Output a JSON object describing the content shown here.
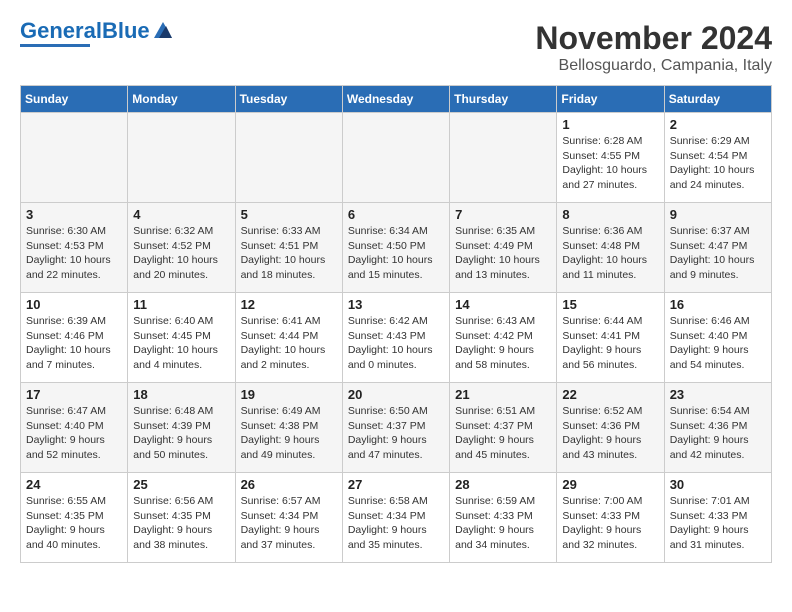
{
  "header": {
    "logo_general": "General",
    "logo_blue": "Blue",
    "title": "November 2024",
    "subtitle": "Bellosguardo, Campania, Italy"
  },
  "calendar": {
    "weekdays": [
      "Sunday",
      "Monday",
      "Tuesday",
      "Wednesday",
      "Thursday",
      "Friday",
      "Saturday"
    ],
    "weeks": [
      [
        {
          "day": "",
          "info": ""
        },
        {
          "day": "",
          "info": ""
        },
        {
          "day": "",
          "info": ""
        },
        {
          "day": "",
          "info": ""
        },
        {
          "day": "",
          "info": ""
        },
        {
          "day": "1",
          "info": "Sunrise: 6:28 AM\nSunset: 4:55 PM\nDaylight: 10 hours\nand 27 minutes."
        },
        {
          "day": "2",
          "info": "Sunrise: 6:29 AM\nSunset: 4:54 PM\nDaylight: 10 hours\nand 24 minutes."
        }
      ],
      [
        {
          "day": "3",
          "info": "Sunrise: 6:30 AM\nSunset: 4:53 PM\nDaylight: 10 hours\nand 22 minutes."
        },
        {
          "day": "4",
          "info": "Sunrise: 6:32 AM\nSunset: 4:52 PM\nDaylight: 10 hours\nand 20 minutes."
        },
        {
          "day": "5",
          "info": "Sunrise: 6:33 AM\nSunset: 4:51 PM\nDaylight: 10 hours\nand 18 minutes."
        },
        {
          "day": "6",
          "info": "Sunrise: 6:34 AM\nSunset: 4:50 PM\nDaylight: 10 hours\nand 15 minutes."
        },
        {
          "day": "7",
          "info": "Sunrise: 6:35 AM\nSunset: 4:49 PM\nDaylight: 10 hours\nand 13 minutes."
        },
        {
          "day": "8",
          "info": "Sunrise: 6:36 AM\nSunset: 4:48 PM\nDaylight: 10 hours\nand 11 minutes."
        },
        {
          "day": "9",
          "info": "Sunrise: 6:37 AM\nSunset: 4:47 PM\nDaylight: 10 hours\nand 9 minutes."
        }
      ],
      [
        {
          "day": "10",
          "info": "Sunrise: 6:39 AM\nSunset: 4:46 PM\nDaylight: 10 hours\nand 7 minutes."
        },
        {
          "day": "11",
          "info": "Sunrise: 6:40 AM\nSunset: 4:45 PM\nDaylight: 10 hours\nand 4 minutes."
        },
        {
          "day": "12",
          "info": "Sunrise: 6:41 AM\nSunset: 4:44 PM\nDaylight: 10 hours\nand 2 minutes."
        },
        {
          "day": "13",
          "info": "Sunrise: 6:42 AM\nSunset: 4:43 PM\nDaylight: 10 hours\nand 0 minutes."
        },
        {
          "day": "14",
          "info": "Sunrise: 6:43 AM\nSunset: 4:42 PM\nDaylight: 9 hours\nand 58 minutes."
        },
        {
          "day": "15",
          "info": "Sunrise: 6:44 AM\nSunset: 4:41 PM\nDaylight: 9 hours\nand 56 minutes."
        },
        {
          "day": "16",
          "info": "Sunrise: 6:46 AM\nSunset: 4:40 PM\nDaylight: 9 hours\nand 54 minutes."
        }
      ],
      [
        {
          "day": "17",
          "info": "Sunrise: 6:47 AM\nSunset: 4:40 PM\nDaylight: 9 hours\nand 52 minutes."
        },
        {
          "day": "18",
          "info": "Sunrise: 6:48 AM\nSunset: 4:39 PM\nDaylight: 9 hours\nand 50 minutes."
        },
        {
          "day": "19",
          "info": "Sunrise: 6:49 AM\nSunset: 4:38 PM\nDaylight: 9 hours\nand 49 minutes."
        },
        {
          "day": "20",
          "info": "Sunrise: 6:50 AM\nSunset: 4:37 PM\nDaylight: 9 hours\nand 47 minutes."
        },
        {
          "day": "21",
          "info": "Sunrise: 6:51 AM\nSunset: 4:37 PM\nDaylight: 9 hours\nand 45 minutes."
        },
        {
          "day": "22",
          "info": "Sunrise: 6:52 AM\nSunset: 4:36 PM\nDaylight: 9 hours\nand 43 minutes."
        },
        {
          "day": "23",
          "info": "Sunrise: 6:54 AM\nSunset: 4:36 PM\nDaylight: 9 hours\nand 42 minutes."
        }
      ],
      [
        {
          "day": "24",
          "info": "Sunrise: 6:55 AM\nSunset: 4:35 PM\nDaylight: 9 hours\nand 40 minutes."
        },
        {
          "day": "25",
          "info": "Sunrise: 6:56 AM\nSunset: 4:35 PM\nDaylight: 9 hours\nand 38 minutes."
        },
        {
          "day": "26",
          "info": "Sunrise: 6:57 AM\nSunset: 4:34 PM\nDaylight: 9 hours\nand 37 minutes."
        },
        {
          "day": "27",
          "info": "Sunrise: 6:58 AM\nSunset: 4:34 PM\nDaylight: 9 hours\nand 35 minutes."
        },
        {
          "day": "28",
          "info": "Sunrise: 6:59 AM\nSunset: 4:33 PM\nDaylight: 9 hours\nand 34 minutes."
        },
        {
          "day": "29",
          "info": "Sunrise: 7:00 AM\nSunset: 4:33 PM\nDaylight: 9 hours\nand 32 minutes."
        },
        {
          "day": "30",
          "info": "Sunrise: 7:01 AM\nSunset: 4:33 PM\nDaylight: 9 hours\nand 31 minutes."
        }
      ]
    ]
  }
}
